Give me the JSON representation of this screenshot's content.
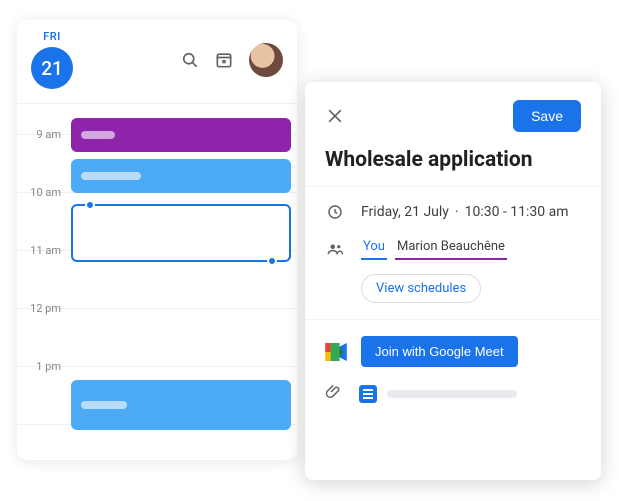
{
  "calendar": {
    "day_label": "FRI",
    "day_number": "21",
    "hours": [
      "9 am",
      "10 am",
      "11 am",
      "12 pm",
      "1 pm"
    ]
  },
  "detail": {
    "save_label": "Save",
    "title": "Wholesale application",
    "date_text": "Friday, 21 July",
    "time_text": "10:30 - 11:30 am",
    "guests": {
      "you_label": "You",
      "other_label": "Marion Beauchêne"
    },
    "view_schedules_label": "View schedules",
    "meet_button_label": "Join with Google Meet"
  }
}
